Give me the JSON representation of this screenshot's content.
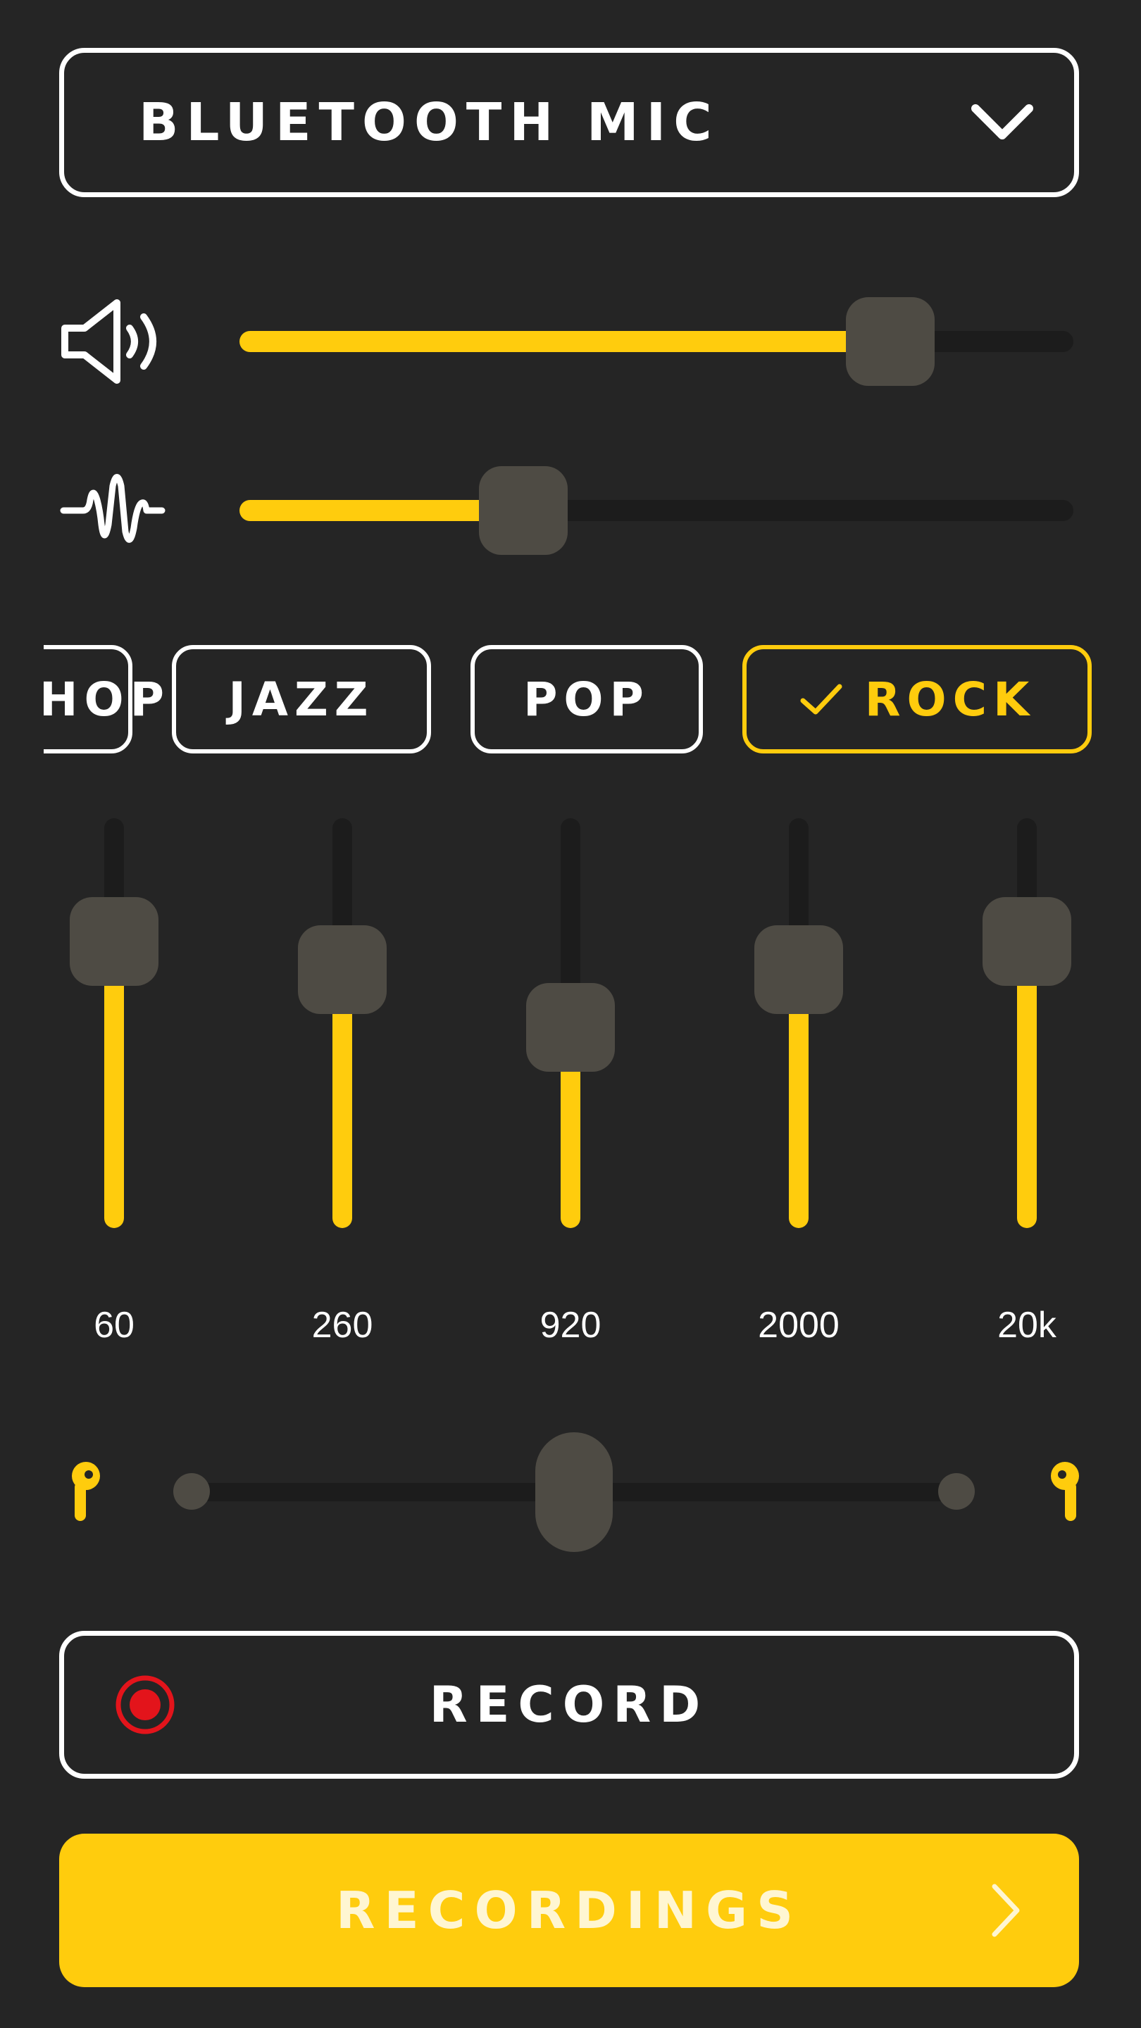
{
  "source": {
    "label": "BLUETOOTH MIC",
    "icon": "chevron-down-icon"
  },
  "volume": {
    "icon": "speaker-icon",
    "level": 0.78
  },
  "gain": {
    "icon": "waveform-icon",
    "level": 0.34
  },
  "presets": {
    "items": [
      {
        "label": "HIP HOP",
        "selected": false
      },
      {
        "label": "JAZZ",
        "selected": false
      },
      {
        "label": "POP",
        "selected": false
      },
      {
        "label": "ROCK",
        "selected": true
      }
    ],
    "selected_icon": "check-icon"
  },
  "equalizer": {
    "bands": [
      {
        "label": "60",
        "level": 0.7
      },
      {
        "label": "260",
        "level": 0.63
      },
      {
        "label": "920",
        "level": 0.49
      },
      {
        "label": "2000",
        "level": 0.63
      },
      {
        "label": "20k",
        "level": 0.7
      }
    ]
  },
  "balance": {
    "left_icon": "left-earbud-icon",
    "right_icon": "right-earbud-icon",
    "level": 0.5
  },
  "record": {
    "label": "RECORD",
    "icon": "record-icon"
  },
  "recordings": {
    "label": "RECORDINGS",
    "icon": "chevron-right-icon"
  },
  "colors": {
    "background": "#252525",
    "accent": "#ffcc0d",
    "thumb": "#4e4b44",
    "track": "#1c1c1c",
    "record_red": "#e3141b"
  }
}
